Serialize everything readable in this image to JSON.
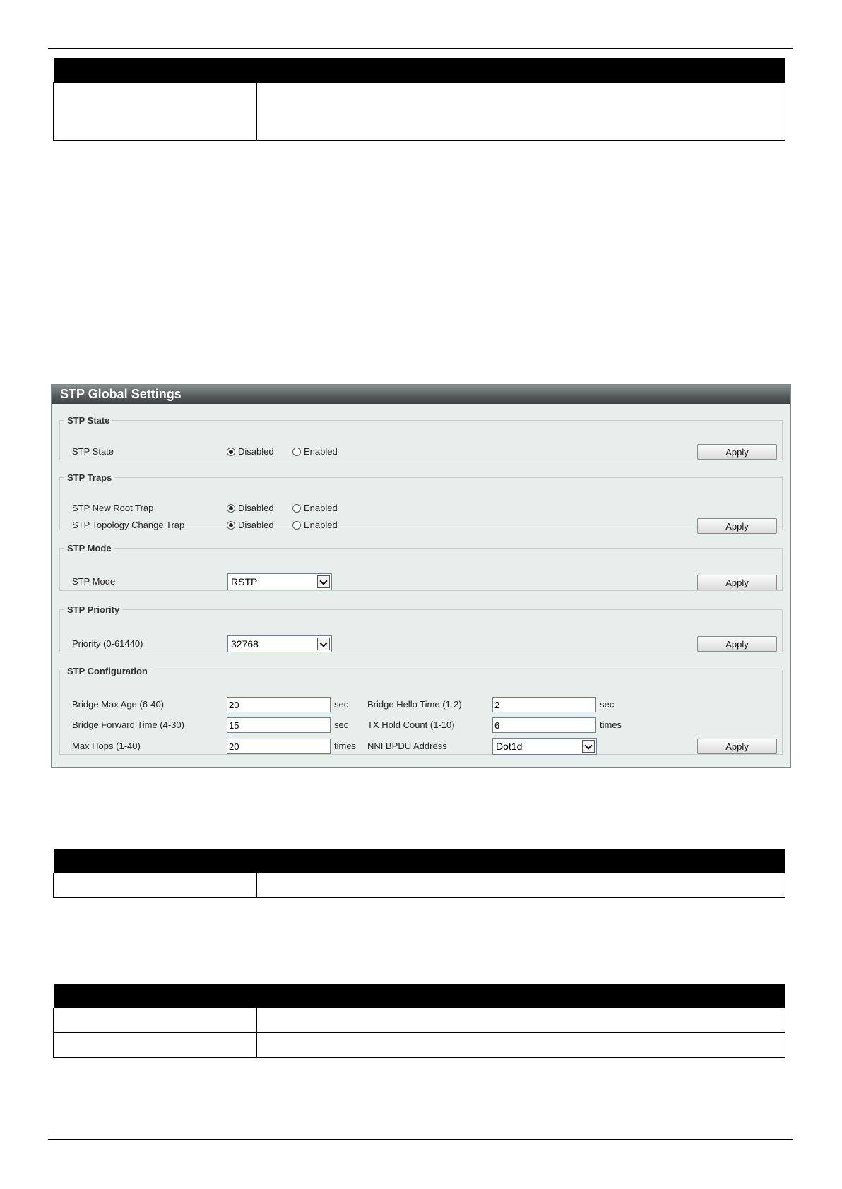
{
  "panel": {
    "title": "STP Global Settings"
  },
  "stp_state": {
    "legend": "STP State",
    "label": "STP State",
    "options": [
      "Disabled",
      "Enabled"
    ],
    "selected": "Disabled",
    "apply": "Apply"
  },
  "stp_traps": {
    "legend": "STP Traps",
    "new_root_label": "STP New Root Trap",
    "topology_label": "STP Topology Change Trap",
    "options": [
      "Disabled",
      "Enabled"
    ],
    "new_root_selected": "Disabled",
    "topology_selected": "Disabled",
    "apply": "Apply"
  },
  "stp_mode": {
    "legend": "STP Mode",
    "label": "STP Mode",
    "value": "RSTP",
    "apply": "Apply"
  },
  "stp_priority": {
    "legend": "STP Priority",
    "label": "Priority (0-61440)",
    "value": "32768",
    "apply": "Apply"
  },
  "stp_config": {
    "legend": "STP Configuration",
    "max_age_label": "Bridge Max Age (6-40)",
    "max_age_value": "20",
    "max_age_unit": "sec",
    "forward_time_label": "Bridge Forward Time (4-30)",
    "forward_time_value": "15",
    "forward_time_unit": "sec",
    "max_hops_label": "Max Hops (1-40)",
    "max_hops_value": "20",
    "max_hops_unit": "times",
    "hello_time_label": "Bridge Hello Time (1-2)",
    "hello_time_value": "2",
    "hello_time_unit": "sec",
    "tx_hold_label": "TX Hold Count (1-10)",
    "tx_hold_value": "6",
    "tx_hold_unit": "times",
    "nni_label": "NNI BPDU Address",
    "nni_value": "Dot1d",
    "apply": "Apply"
  }
}
